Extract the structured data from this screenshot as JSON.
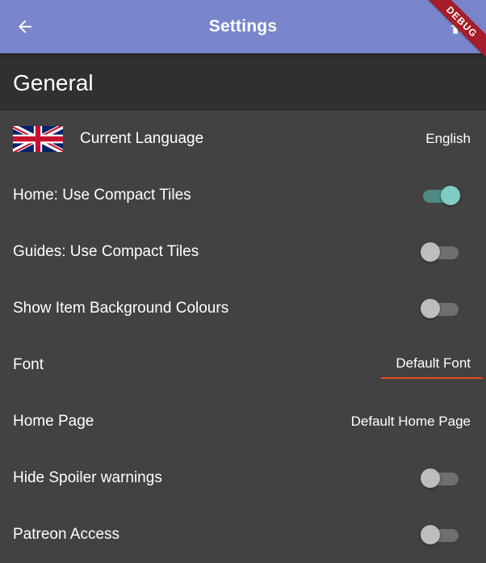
{
  "app_bar": {
    "title": "Settings",
    "debug_banner": "DEBUG",
    "background_color": "#7986cb",
    "back_icon": "arrow-left-icon",
    "action_icon": "home-icon"
  },
  "section": {
    "title": "General"
  },
  "settings": {
    "language": {
      "label": "Current Language",
      "value": "English",
      "flag_icon": "uk-flag-icon"
    },
    "compact_home": {
      "label": "Home: Use Compact Tiles",
      "enabled": true
    },
    "compact_guides": {
      "label": "Guides: Use Compact Tiles",
      "enabled": false
    },
    "item_background": {
      "label": "Show Item Background Colours",
      "enabled": false
    },
    "font": {
      "label": "Font",
      "value": "Default Font",
      "underline_color": "#e64a19"
    },
    "home_page": {
      "label": "Home Page",
      "value": "Default Home Page"
    },
    "hide_spoilers": {
      "label": "Hide Spoiler warnings",
      "enabled": false
    },
    "patreon": {
      "label": "Patreon Access",
      "enabled": false
    }
  },
  "colors": {
    "toggle_on_thumb": "#80cbc4",
    "toggle_off_thumb": "#bdbdbd",
    "page_background": "#424242",
    "section_background": "#303030"
  }
}
